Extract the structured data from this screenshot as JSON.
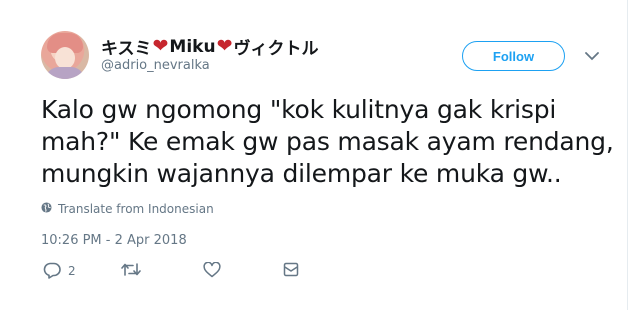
{
  "author": {
    "display_name_part1": "キスミ",
    "display_name_part2": "Miku",
    "display_name_part3": "ヴィクトル",
    "heart_glyph": "❤",
    "handle": "@adrio_nevralka"
  },
  "follow_label": "Follow",
  "tweet": {
    "text": "Kalo gw ngomong \"kok kulitnya gak krispi mah?\" Ke emak gw pas masak ayam rendang, mungkin wajannya dilempar ke muka gw..",
    "translate_label": "Translate from Indonesian",
    "timestamp": "10:26 PM - 2 Apr 2018"
  },
  "actions": {
    "reply_count": "2"
  },
  "colors": {
    "accent": "#1da1f2",
    "muted": "#657786",
    "heart": "#c6262e"
  },
  "icons": [
    "reply-icon",
    "retweet-icon",
    "like-icon",
    "dm-icon",
    "globe-icon",
    "chevron-down-icon"
  ]
}
